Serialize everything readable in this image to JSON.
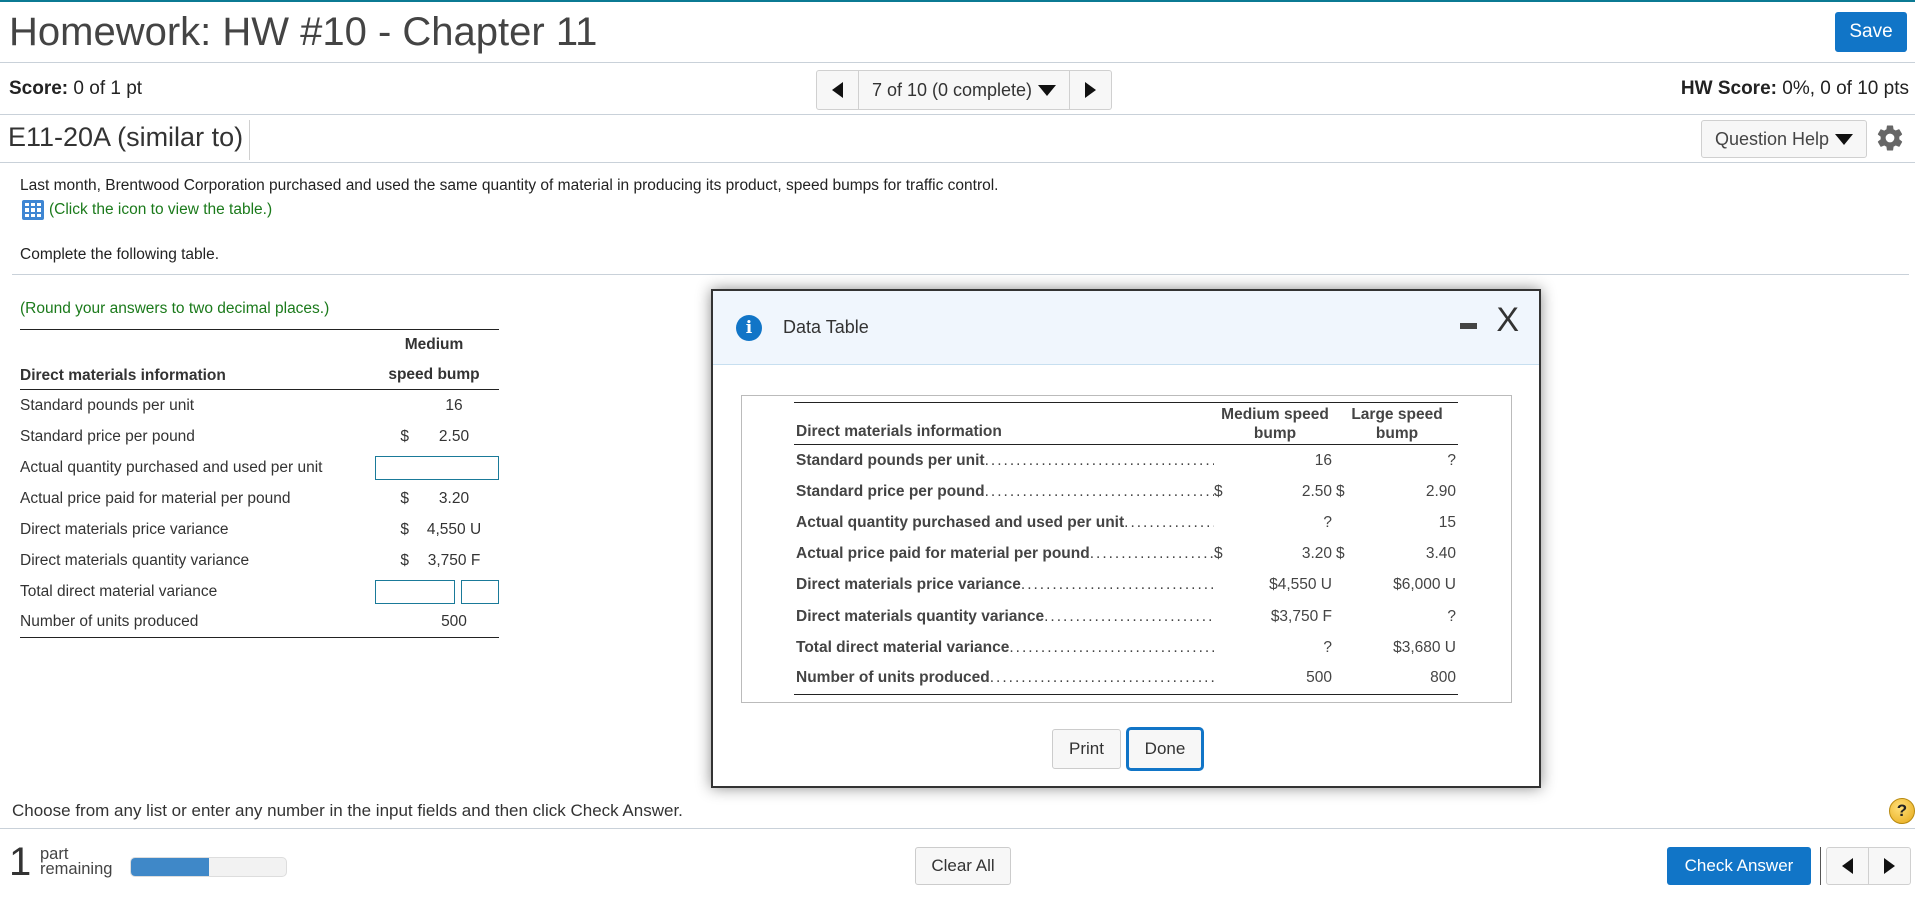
{
  "header": {
    "title": "Homework: HW #10 - Chapter 11",
    "save_label": "Save",
    "score_label": "Score:",
    "score_value": " 0 of 1 pt",
    "hw_score_label": "HW Score:",
    "hw_score_value": " 0%, 0 of 10 pts",
    "question_nav": "7 of 10 (0 complete)"
  },
  "question": {
    "id": "E11-20A (similar to)",
    "help_label": "Question Help",
    "intro": "Last month, Brentwood Corporation purchased and used the same quantity of material in producing its product, speed bumps for traffic control.",
    "table_link": "(Click the icon to view the table.)",
    "instruction": "Complete the following table.",
    "round_note": "(Round your answers to two decimal places.)"
  },
  "answer_table": {
    "header_label": "Direct materials information",
    "column_header_line1": "Medium",
    "column_header_line2": "speed bump",
    "rows": [
      {
        "label": "Standard pounds per unit",
        "currency": "",
        "value": "16"
      },
      {
        "label": "Standard price per pound",
        "currency": "$",
        "value": "2.50"
      },
      {
        "label": "Actual quantity purchased and used per unit",
        "currency": "",
        "value": "",
        "input": true
      },
      {
        "label": "Actual price paid for material per pound",
        "currency": "$",
        "value": "3.20"
      },
      {
        "label": "Direct materials price variance",
        "currency": "$",
        "value": "4,550 U"
      },
      {
        "label": "Direct materials quantity variance",
        "currency": "$",
        "value": "3,750 F"
      },
      {
        "label": "Total direct material variance",
        "currency": "",
        "value": "",
        "input": true,
        "second_input": true
      },
      {
        "label": "Number of units produced",
        "currency": "",
        "value": "500"
      }
    ]
  },
  "footer": {
    "instruction": "Choose from any list or enter any number in the input fields and then click Check Answer.",
    "parts_count": "1",
    "parts_label_line1": "part",
    "parts_label_line2": "remaining",
    "progress_fraction": 0.5,
    "clear_all_label": "Clear All",
    "check_answer_label": "Check Answer",
    "help_icon": "?"
  },
  "modal": {
    "title": "Data Table",
    "info_icon": "i",
    "close_icon": "X",
    "header_label": "Direct materials information",
    "col1_header": "Medium speed bump",
    "col2_header": "Large speed bump",
    "rows": [
      {
        "label": "Standard pounds per unit",
        "cur1": "",
        "v1": "16",
        "cur2": "",
        "v2": "?"
      },
      {
        "label": "Standard price per pound",
        "cur1": "$",
        "v1": "2.50",
        "cur2": "$",
        "v2": "2.90"
      },
      {
        "label": "Actual quantity purchased and used per unit ",
        "cur1": "",
        "v1": "?",
        "cur2": "",
        "v2": "15"
      },
      {
        "label": "Actual price paid for material per pound",
        "cur1": "$",
        "v1": "3.20",
        "cur2": "$",
        "v2": "3.40"
      },
      {
        "label": "Direct materials price variance",
        "cur1": "",
        "v1": "$4,550 U",
        "cur2": "",
        "v2": "$6,000 U"
      },
      {
        "label": "Direct materials quantity variance",
        "cur1": "",
        "v1": "$3,750 F",
        "cur2": "",
        "v2": "?"
      },
      {
        "label": "Total direct material variance",
        "cur1": "",
        "v1": "?",
        "cur2": "",
        "v2": "$3,680 U"
      },
      {
        "label": "Number of units produced ",
        "cur1": "",
        "v1": "500",
        "cur2": "",
        "v2": "800"
      }
    ],
    "print_label": "Print",
    "done_label": "Done"
  }
}
